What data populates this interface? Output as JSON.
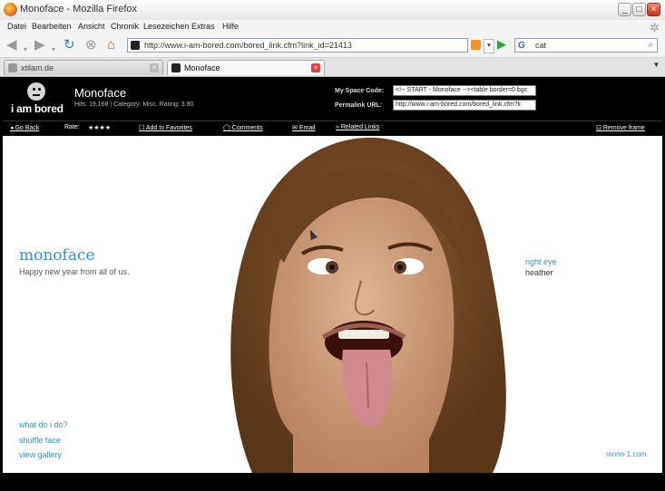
{
  "window": {
    "title": "Monoface - Mozilla Firefox",
    "btn_minimize": "_",
    "btn_maximize": "□",
    "btn_close": "×"
  },
  "menu": [
    "Datei",
    "Bearbeiten",
    "Ansicht",
    "Chronik",
    "Lesezeichen",
    "Extras",
    "Hilfe"
  ],
  "nav": {
    "url": "http://www.i-am-bored.com/bored_link.cfm?link_id=21413",
    "search_value": "cat",
    "search_engine": "G"
  },
  "tabs": [
    {
      "label": "xtilam.de",
      "active": false
    },
    {
      "label": "Monoface",
      "active": true
    }
  ],
  "site": {
    "logo": "i am bored",
    "game_title": "Monoface",
    "meta": "Hits: 19,168  |  Category: Misc.  Rating: 3.80",
    "myspace_label": "My Space Code:",
    "myspace_value": "<!-- START - Monoface --><table border=0 bgc",
    "permalink_label": "Permalink URL:",
    "permalink_value": "http://www.i-am-bored.com/bored_link.cfm?li",
    "subnav": {
      "back": "Go Back",
      "rate": "Rate:",
      "stars": "★★★★",
      "favorites": "Add to Favorites",
      "comments": "Comments",
      "email": "Email",
      "related": "Related Links",
      "remove": "Remove frame"
    }
  },
  "game": {
    "title": "monoface",
    "tagline": "Happy new year from all of us.",
    "part": "right eye",
    "person": "heather",
    "what": "what do i do?",
    "shuffle": "shuffle face",
    "gallery": "view gallery",
    "credit": "mono-1.com",
    "accent_color": "#3a8fc9"
  }
}
